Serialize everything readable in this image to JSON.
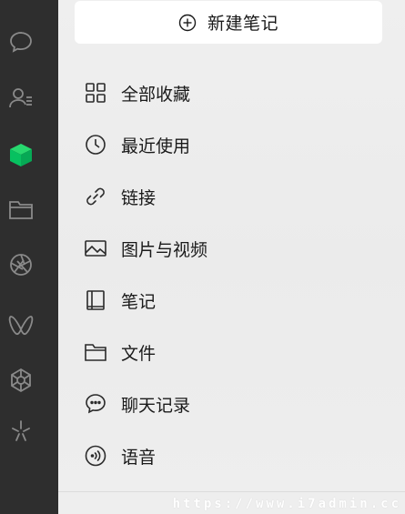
{
  "new_note": {
    "label": "新建笔记",
    "icon": "plus-circle-icon"
  },
  "sidebar": {
    "items": [
      {
        "name": "chat-icon",
        "active": false
      },
      {
        "name": "contacts-icon",
        "active": false
      },
      {
        "name": "favorites-cube-icon",
        "active": true
      },
      {
        "name": "folder-icon",
        "active": false
      },
      {
        "name": "moments-aperture-icon",
        "active": false
      },
      {
        "name": "channels-butterfly-icon",
        "active": false
      },
      {
        "name": "miniprogram-flower-icon",
        "active": false
      },
      {
        "name": "search-spark-icon",
        "active": false
      }
    ],
    "active_color": "#07c160",
    "icon_color": "#8a8a8a"
  },
  "menu": {
    "items": [
      {
        "label": "全部收藏",
        "icon": "grid-icon"
      },
      {
        "label": "最近使用",
        "icon": "clock-icon"
      },
      {
        "label": "链接",
        "icon": "link-icon"
      },
      {
        "label": "图片与视频",
        "icon": "image-icon"
      },
      {
        "label": "笔记",
        "icon": "notebook-icon"
      },
      {
        "label": "文件",
        "icon": "folder-icon"
      },
      {
        "label": "聊天记录",
        "icon": "chat-bubble-icon"
      },
      {
        "label": "语音",
        "icon": "voice-icon"
      }
    ]
  },
  "watermark": "https://www.i7admin.cc"
}
